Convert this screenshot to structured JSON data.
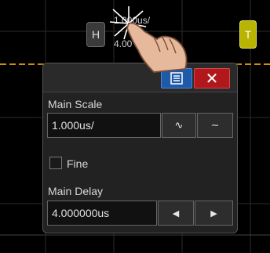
{
  "toolbar": {
    "h_label": "H",
    "t_label": "T",
    "timebase_line1": "1.000us/",
    "timebase_line2": "4.00"
  },
  "dialog": {
    "main_scale_label": "Main Scale",
    "main_scale_value": "1.000us/",
    "fine_label": "Fine",
    "main_delay_label": "Main Delay",
    "main_delay_value": "4.000000us",
    "close_glyph": "✕",
    "scale_small_glyph": "∿",
    "scale_large_glyph": "∼",
    "delay_left_glyph": "◀",
    "delay_right_glyph": "▶"
  },
  "colors": {
    "menu_button": "#1f5aa8",
    "close_button": "#b0181c",
    "trigger_button": "#b8b400",
    "trigger_level_line": "#d09000"
  },
  "icons": {
    "menu": "menu-icon",
    "close": "close-icon",
    "touch": "touch-hand-icon"
  }
}
